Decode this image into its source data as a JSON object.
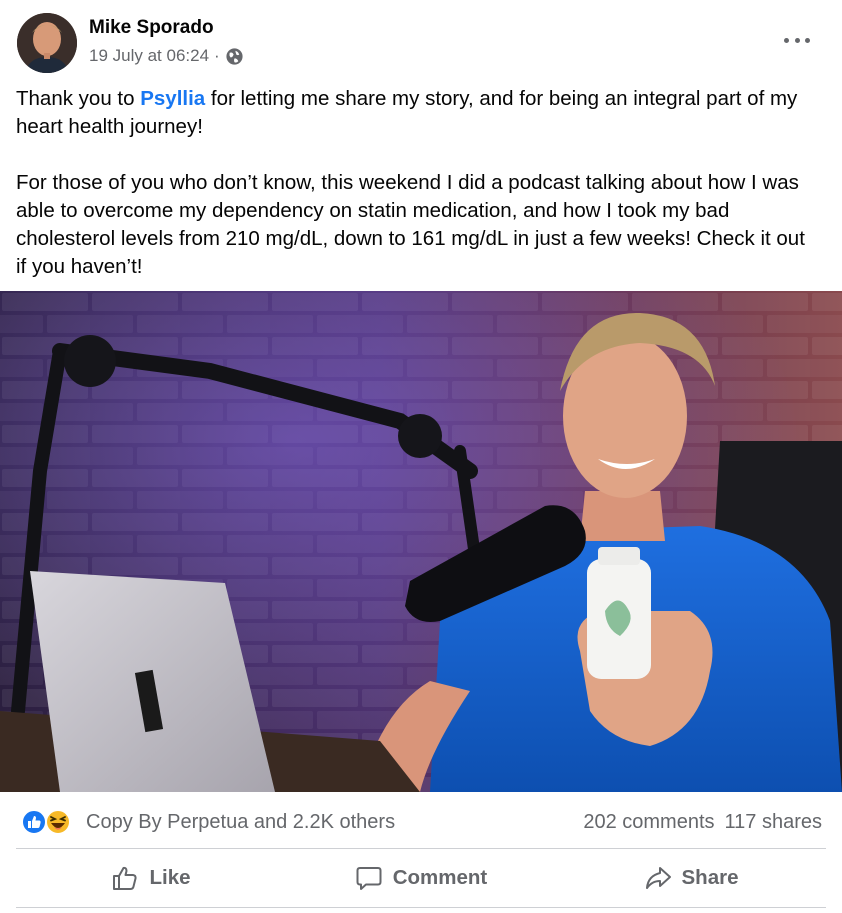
{
  "post": {
    "author": "Mike Sporado",
    "date": "19 July at 06:24",
    "separator": "·",
    "visibility_icon": "globe-icon",
    "more_icon": "more-options-icon",
    "text": {
      "p1_before": "Thank you to ",
      "p1_link": "Psyllia",
      "p1_after": " for letting me share my story, and for being an integral part of my heart health journey!",
      "p2": "For those of you who don’t know, this weekend I did a podcast talking about how I was able to overcome my dependency on statin medication, and how I took my bad cholesterol levels from 210 mg/dL, down to 161 mg/dL in just a few weeks! Check it out if you haven’t!"
    }
  },
  "reactions": {
    "summary": "Copy By Perpetua and 2.2K others",
    "icons": [
      "like-reaction-icon",
      "haha-reaction-icon"
    ],
    "comments": "202 comments",
    "shares": "117 shares"
  },
  "actions": {
    "like": "Like",
    "comment": "Comment",
    "share": "Share"
  },
  "colors": {
    "link": "#1877f2",
    "secondary_text": "#65676b",
    "like_blue": "#1877f2",
    "haha_yellow": "#f7b928"
  }
}
